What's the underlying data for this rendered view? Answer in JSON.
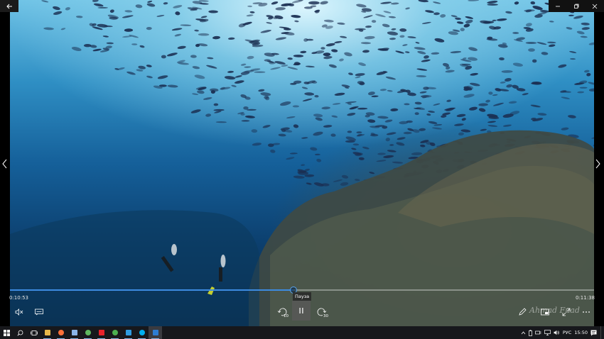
{
  "window": {
    "back_icon": "back-arrow-icon",
    "minimize_icon": "minimize-icon",
    "maximize_icon": "maximize-icon",
    "close_icon": "close-icon"
  },
  "player": {
    "elapsed": "0:10:53",
    "total": "0:11:38",
    "progress": 0.485,
    "tooltip": "Пауза",
    "rewind_seconds": "10",
    "forward_seconds": "30",
    "watermark": "Ahmad Fuad",
    "accent_color": "#3d8be0"
  },
  "taskbar": {
    "apps": [
      {
        "name": "file-explorer",
        "icon": "folder-icon",
        "color": "#e8b84a"
      },
      {
        "name": "firefox",
        "icon": "firefox-icon",
        "color": "#ff7139"
      },
      {
        "name": "notepad",
        "icon": "notepad-icon",
        "color": "#8ab4e8"
      },
      {
        "name": "app-green",
        "icon": "app-green-icon",
        "color": "#5fb85f"
      },
      {
        "name": "opera",
        "icon": "opera-icon",
        "color": "#e8232c"
      },
      {
        "name": "chrome",
        "icon": "chrome-icon",
        "color": "#4caf50"
      },
      {
        "name": "edge",
        "icon": "edge-icon",
        "color": "#2f9be0"
      },
      {
        "name": "skype",
        "icon": "skype-icon",
        "color": "#00aff0"
      },
      {
        "name": "movies-tv",
        "icon": "movies-tv-icon",
        "color": "#2d7dd2"
      }
    ],
    "language": "РУС",
    "clock": "15:50"
  }
}
